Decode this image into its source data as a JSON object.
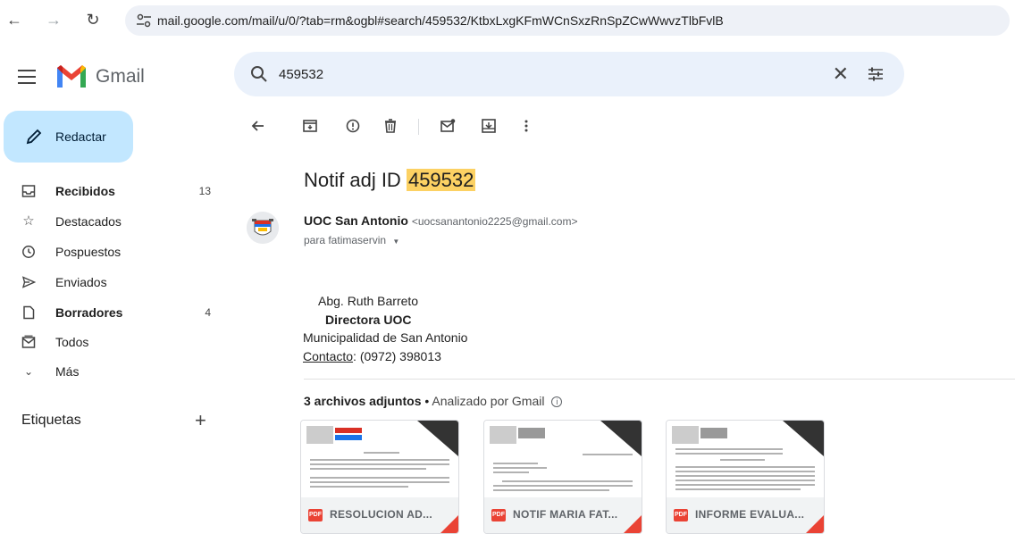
{
  "browser": {
    "url": "mail.google.com/mail/u/0/?tab=rm&ogbl#search/459532/KtbxLxgKFmWCnSxzRnSpZCwWwvzTlbFvlB"
  },
  "app": {
    "name": "Gmail"
  },
  "search": {
    "query": "459532"
  },
  "compose": {
    "label": "Redactar"
  },
  "nav": [
    {
      "label": "Recibidos",
      "count": "13",
      "icon": "inbox-icon",
      "bold": true
    },
    {
      "label": "Destacados",
      "count": "",
      "icon": "star-icon",
      "bold": false
    },
    {
      "label": "Pospuestos",
      "count": "",
      "icon": "clock-icon",
      "bold": false
    },
    {
      "label": "Enviados",
      "count": "",
      "icon": "send-icon",
      "bold": false
    },
    {
      "label": "Borradores",
      "count": "4",
      "icon": "draft-icon",
      "bold": true
    },
    {
      "label": "Todos",
      "count": "",
      "icon": "all-mail-icon",
      "bold": false
    },
    {
      "label": "Más",
      "count": "",
      "icon": "chevron-down-icon",
      "bold": false
    }
  ],
  "labels": {
    "title": "Etiquetas"
  },
  "email": {
    "subject_prefix": "Notif adj ID",
    "subject_highlight": "459532",
    "sender_name": "UOC San Antonio",
    "sender_email": "<uocsanantonio2225@gmail.com>",
    "to": "para fatimaservin",
    "signature": {
      "line1": "Abg. Ruth Barreto",
      "line2": "Directora UOC",
      "line3": "Municipalidad de San Antonio",
      "contact_link": "Contacto",
      "contact_rest": ": (0972) 398013"
    }
  },
  "attachments": {
    "count_label": "3 archivos adjuntos",
    "separator": " • ",
    "scan_label": "Analizado por Gmail",
    "files": [
      {
        "name": "RESOLUCION AD...",
        "type": "PDF"
      },
      {
        "name": "NOTIF MARIA FAT...",
        "type": "PDF"
      },
      {
        "name": "INFORME EVALUA...",
        "type": "PDF"
      }
    ]
  },
  "colors": {
    "accent": "#c2e7ff",
    "highlight": "#fcd163",
    "pdf_red": "#ea4335",
    "search_bg": "#eaf1fb"
  }
}
